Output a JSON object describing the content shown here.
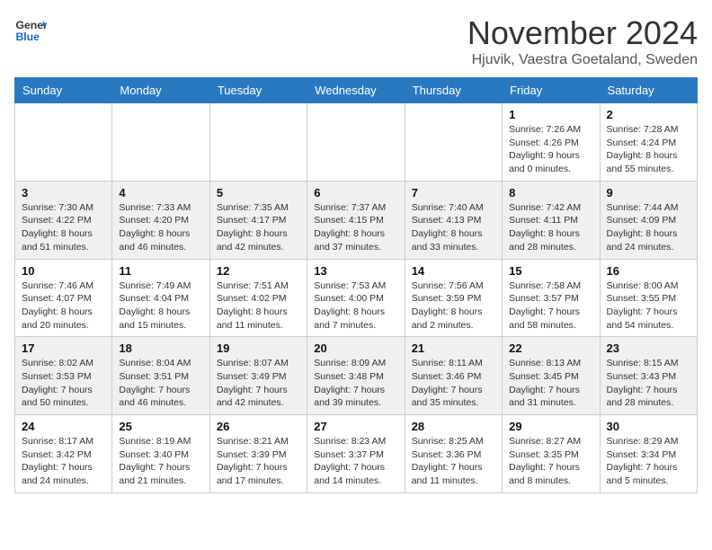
{
  "header": {
    "logo_general": "General",
    "logo_blue": "Blue",
    "month": "November 2024",
    "location": "Hjuvik, Vaestra Goetaland, Sweden"
  },
  "weekdays": [
    "Sunday",
    "Monday",
    "Tuesday",
    "Wednesday",
    "Thursday",
    "Friday",
    "Saturday"
  ],
  "weeks": [
    [
      {
        "day": "",
        "info": ""
      },
      {
        "day": "",
        "info": ""
      },
      {
        "day": "",
        "info": ""
      },
      {
        "day": "",
        "info": ""
      },
      {
        "day": "",
        "info": ""
      },
      {
        "day": "1",
        "info": "Sunrise: 7:26 AM\nSunset: 4:26 PM\nDaylight: 9 hours\nand 0 minutes."
      },
      {
        "day": "2",
        "info": "Sunrise: 7:28 AM\nSunset: 4:24 PM\nDaylight: 8 hours\nand 55 minutes."
      }
    ],
    [
      {
        "day": "3",
        "info": "Sunrise: 7:30 AM\nSunset: 4:22 PM\nDaylight: 8 hours\nand 51 minutes."
      },
      {
        "day": "4",
        "info": "Sunrise: 7:33 AM\nSunset: 4:20 PM\nDaylight: 8 hours\nand 46 minutes."
      },
      {
        "day": "5",
        "info": "Sunrise: 7:35 AM\nSunset: 4:17 PM\nDaylight: 8 hours\nand 42 minutes."
      },
      {
        "day": "6",
        "info": "Sunrise: 7:37 AM\nSunset: 4:15 PM\nDaylight: 8 hours\nand 37 minutes."
      },
      {
        "day": "7",
        "info": "Sunrise: 7:40 AM\nSunset: 4:13 PM\nDaylight: 8 hours\nand 33 minutes."
      },
      {
        "day": "8",
        "info": "Sunrise: 7:42 AM\nSunset: 4:11 PM\nDaylight: 8 hours\nand 28 minutes."
      },
      {
        "day": "9",
        "info": "Sunrise: 7:44 AM\nSunset: 4:09 PM\nDaylight: 8 hours\nand 24 minutes."
      }
    ],
    [
      {
        "day": "10",
        "info": "Sunrise: 7:46 AM\nSunset: 4:07 PM\nDaylight: 8 hours\nand 20 minutes."
      },
      {
        "day": "11",
        "info": "Sunrise: 7:49 AM\nSunset: 4:04 PM\nDaylight: 8 hours\nand 15 minutes."
      },
      {
        "day": "12",
        "info": "Sunrise: 7:51 AM\nSunset: 4:02 PM\nDaylight: 8 hours\nand 11 minutes."
      },
      {
        "day": "13",
        "info": "Sunrise: 7:53 AM\nSunset: 4:00 PM\nDaylight: 8 hours\nand 7 minutes."
      },
      {
        "day": "14",
        "info": "Sunrise: 7:56 AM\nSunset: 3:59 PM\nDaylight: 8 hours\nand 2 minutes."
      },
      {
        "day": "15",
        "info": "Sunrise: 7:58 AM\nSunset: 3:57 PM\nDaylight: 7 hours\nand 58 minutes."
      },
      {
        "day": "16",
        "info": "Sunrise: 8:00 AM\nSunset: 3:55 PM\nDaylight: 7 hours\nand 54 minutes."
      }
    ],
    [
      {
        "day": "17",
        "info": "Sunrise: 8:02 AM\nSunset: 3:53 PM\nDaylight: 7 hours\nand 50 minutes."
      },
      {
        "day": "18",
        "info": "Sunrise: 8:04 AM\nSunset: 3:51 PM\nDaylight: 7 hours\nand 46 minutes."
      },
      {
        "day": "19",
        "info": "Sunrise: 8:07 AM\nSunset: 3:49 PM\nDaylight: 7 hours\nand 42 minutes."
      },
      {
        "day": "20",
        "info": "Sunrise: 8:09 AM\nSunset: 3:48 PM\nDaylight: 7 hours\nand 39 minutes."
      },
      {
        "day": "21",
        "info": "Sunrise: 8:11 AM\nSunset: 3:46 PM\nDaylight: 7 hours\nand 35 minutes."
      },
      {
        "day": "22",
        "info": "Sunrise: 8:13 AM\nSunset: 3:45 PM\nDaylight: 7 hours\nand 31 minutes."
      },
      {
        "day": "23",
        "info": "Sunrise: 8:15 AM\nSunset: 3:43 PM\nDaylight: 7 hours\nand 28 minutes."
      }
    ],
    [
      {
        "day": "24",
        "info": "Sunrise: 8:17 AM\nSunset: 3:42 PM\nDaylight: 7 hours\nand 24 minutes."
      },
      {
        "day": "25",
        "info": "Sunrise: 8:19 AM\nSunset: 3:40 PM\nDaylight: 7 hours\nand 21 minutes."
      },
      {
        "day": "26",
        "info": "Sunrise: 8:21 AM\nSunset: 3:39 PM\nDaylight: 7 hours\nand 17 minutes."
      },
      {
        "day": "27",
        "info": "Sunrise: 8:23 AM\nSunset: 3:37 PM\nDaylight: 7 hours\nand 14 minutes."
      },
      {
        "day": "28",
        "info": "Sunrise: 8:25 AM\nSunset: 3:36 PM\nDaylight: 7 hours\nand 11 minutes."
      },
      {
        "day": "29",
        "info": "Sunrise: 8:27 AM\nSunset: 3:35 PM\nDaylight: 7 hours\nand 8 minutes."
      },
      {
        "day": "30",
        "info": "Sunrise: 8:29 AM\nSunset: 3:34 PM\nDaylight: 7 hours\nand 5 minutes."
      }
    ]
  ]
}
